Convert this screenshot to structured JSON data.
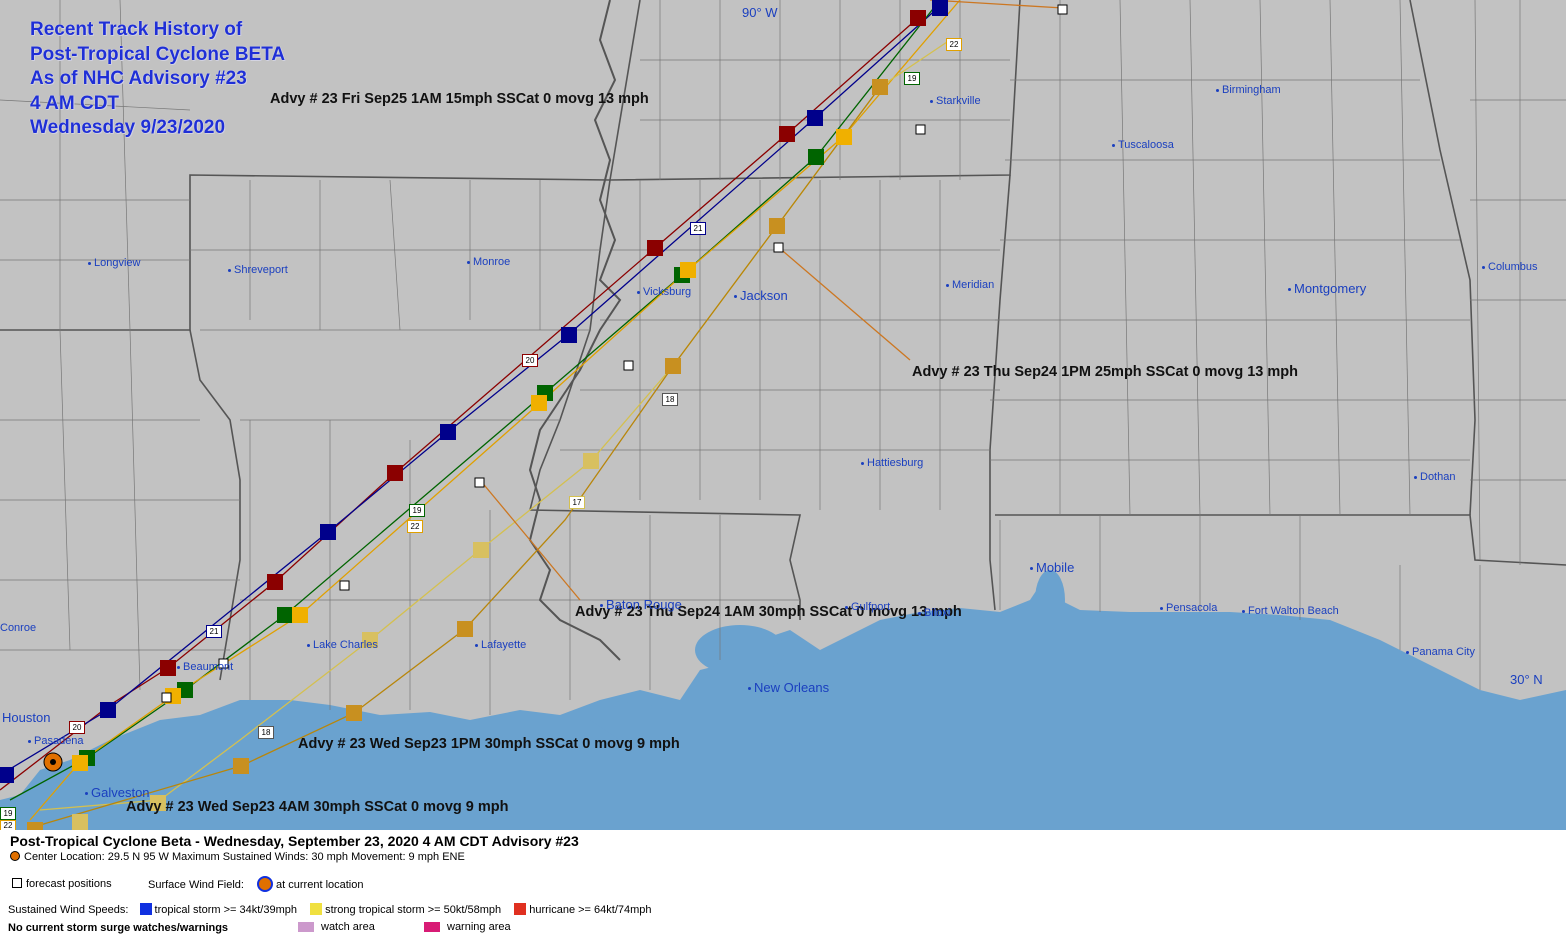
{
  "map": {
    "title_lines": [
      "Recent Track History of",
      "Post-Tropical Cyclone BETA",
      "As of NHC Advisory #23",
      "4 AM CDT",
      "Wednesday 9/23/2020"
    ],
    "coord_labels": {
      "lon": "90° W",
      "lat": "30° N"
    },
    "advisories": [
      "Advy # 23 Fri Sep25 1AM  15mph SSCat 0 movg 13 mph",
      "Advy # 23 Thu Sep24 1PM  25mph SSCat 0 movg 13 mph",
      "Advy # 23 Thu Sep24 1AM  30mph SSCat 0 movg 13 mph",
      "Advy # 23 Wed Sep23 1PM  30mph SSCat 0 movg 9 mph",
      "Advy # 23 Wed Sep23 4AM  30mph SSCat 0 movg 9 mph"
    ],
    "cities": [
      "Longview",
      "Shreveport",
      "Monroe",
      "Vicksburg",
      "Jackson",
      "Starkville",
      "Birmingham",
      "Tuscaloosa",
      "Meridian",
      "Columbus",
      "Montgomery",
      "Hattiesburg",
      "Dothan",
      "Mobile",
      "Pensacola",
      "Fort Walton Beach",
      "Panama City",
      "Baton Rouge",
      "Gulfport",
      "Biloxi",
      "New Orleans",
      "Lafayette",
      "Lake Charles",
      "Beaumont",
      "Houston",
      "Pasadena",
      "Galveston",
      "Conroe"
    ],
    "shields": [
      "22",
      "19",
      "21",
      "20",
      "18",
      "17",
      "19",
      "22",
      "21",
      "20",
      "18",
      "19",
      "22"
    ]
  },
  "legend": {
    "header": "Post-Tropical Cyclone Beta  -  Wednesday, September 23, 2020  4 AM CDT   Advisory #23",
    "center_info": "Center Location: 29.5 N  95 W   Maximum Sustained Winds: 30 mph  Movement: 9 mph ENE",
    "forecast_positions": "forecast positions",
    "surface_wind_field": "Surface Wind Field:",
    "at_current_location": "at current location",
    "sustained_label": "Sustained Wind Speeds:",
    "ts_label": "tropical storm >= 34kt/39mph",
    "sts_label": "strong tropical storm >= 50kt/58mph",
    "hu_label": "hurricane >= 64kt/74mph",
    "surge_note": "No current storm surge watches/warnings",
    "watch_label": "watch area",
    "warning_label": "warning area",
    "colors": {
      "ts": "#1030e0",
      "sts": "#f0e040",
      "hu": "#e03020",
      "watch": "#cc99cc",
      "warning": "#d81b75",
      "center": "#e07000"
    }
  }
}
